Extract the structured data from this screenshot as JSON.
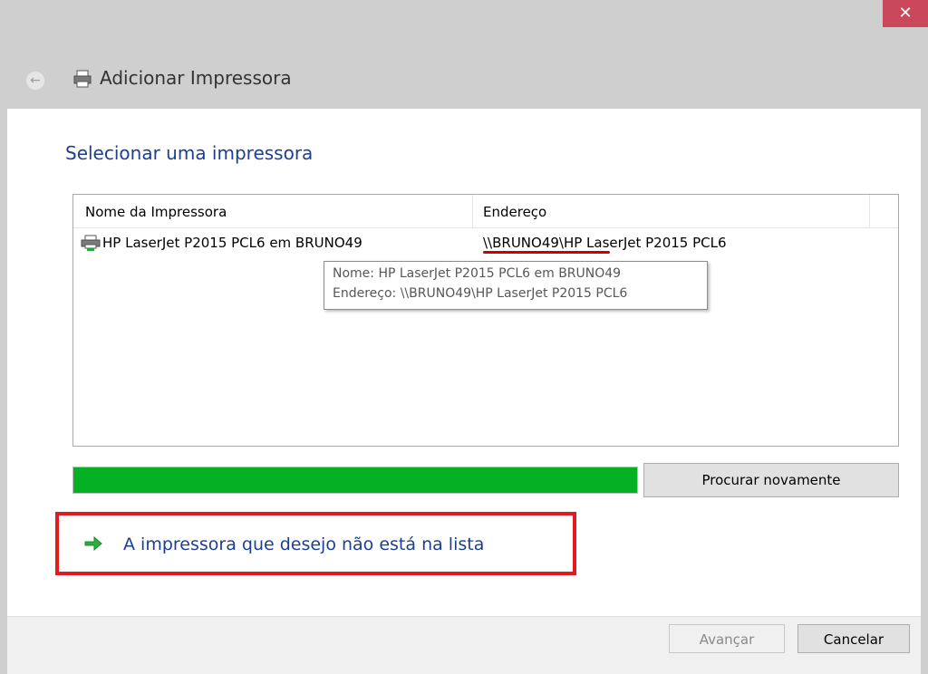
{
  "window": {
    "title": "Adicionar Impressora",
    "close_glyph": "✕",
    "back_glyph": "←"
  },
  "page": {
    "heading": "Selecionar uma impressora"
  },
  "printer_list": {
    "columns": [
      "Nome da Impressora",
      "Endereço"
    ],
    "rows": [
      {
        "name": "HP LaserJet P2015 PCL6 em BRUNO49",
        "address": "\\\\BRUNO49\\HP LaserJet P2015 PCL6"
      }
    ]
  },
  "tooltip": {
    "line1": "Nome: HP LaserJet P2015 PCL6 em BRUNO49",
    "line2": "Endereço: \\\\BRUNO49\\HP LaserJet P2015 PCL6"
  },
  "search": {
    "progress_fraction": 1.0,
    "progress_color": "#06b025",
    "search_again_label": "Procurar novamente"
  },
  "missing_printer_link": "A impressora que desejo não está na lista",
  "footer": {
    "next_label": "Avançar",
    "cancel_label": "Cancelar"
  },
  "colors": {
    "heading": "#1c3f94",
    "highlight_box": "#e11b22",
    "underline_mark": "#cc0000"
  },
  "icons": [
    "close-icon",
    "back-arrow-icon",
    "printer-icon",
    "green-arrow-icon"
  ]
}
